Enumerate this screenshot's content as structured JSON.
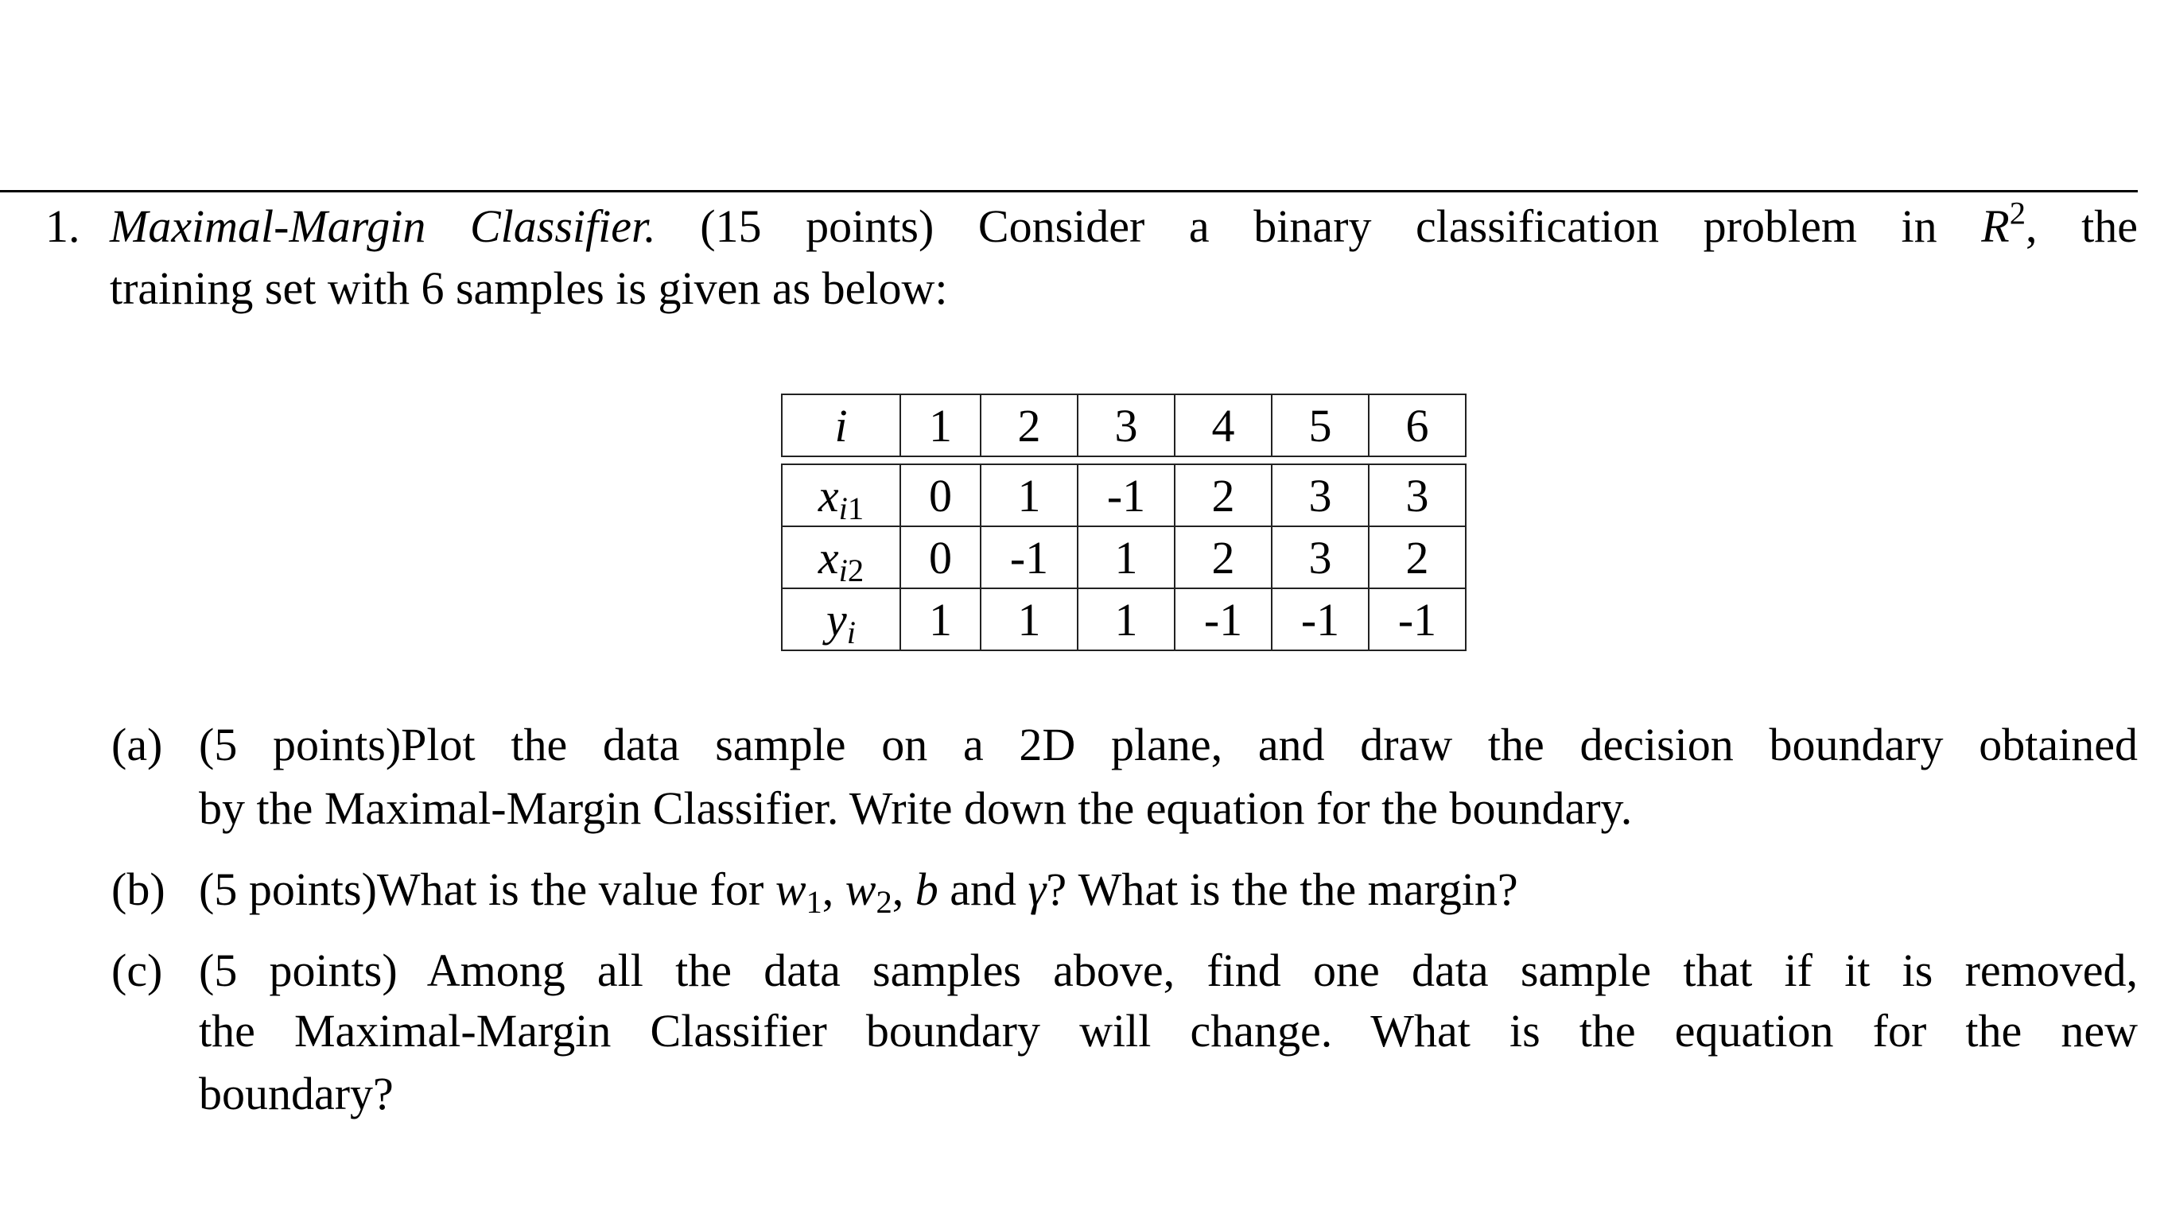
{
  "problem": {
    "number": "1.",
    "title": "Maximal-Margin Classifier.",
    "intro_line1_rest": "(15 points) Consider a binary classification problem in",
    "space_symbol": "R",
    "space_exponent": "2",
    "intro_line1_tail": ", the",
    "intro_line2": "training set with 6 samples is given as below:"
  },
  "table": {
    "header_label": "i",
    "indices": [
      "1",
      "2",
      "3",
      "4",
      "5",
      "6"
    ],
    "rows": [
      {
        "var": "x",
        "sub_i": "i",
        "sub_n": "1",
        "values": [
          "0",
          "1",
          "-1",
          "2",
          "3",
          "3"
        ]
      },
      {
        "var": "x",
        "sub_i": "i",
        "sub_n": "2",
        "values": [
          "0",
          "-1",
          "1",
          "2",
          "3",
          "2"
        ]
      },
      {
        "var": "y",
        "sub_i": "i",
        "sub_n": "",
        "values": [
          "1",
          "1",
          "1",
          "-1",
          "-1",
          "-1"
        ]
      }
    ]
  },
  "subquestions": {
    "a": {
      "label": "(a)",
      "line1": "(5 points)Plot the data sample on a 2D plane, and draw the decision boundary obtained",
      "line2": "by the Maximal-Margin Classifier. Write down the equation for the boundary."
    },
    "b": {
      "label": "(b)",
      "pre": "(5 points)What is the value for",
      "w1": "w",
      "w1_sub": "1",
      "sep1": ", ",
      "w2": "w",
      "w2_sub": "2",
      "sep2": ", ",
      "b": "b",
      "and": " and ",
      "gamma": "γ",
      "post": "? What is the the margin?"
    },
    "c": {
      "label": "(c)",
      "line1": "(5 points) Among all the data samples above, find one data sample that if it is removed,",
      "line2": "the Maximal-Margin Classifier boundary will change. What is the equation for the new",
      "line3": "boundary?"
    }
  }
}
